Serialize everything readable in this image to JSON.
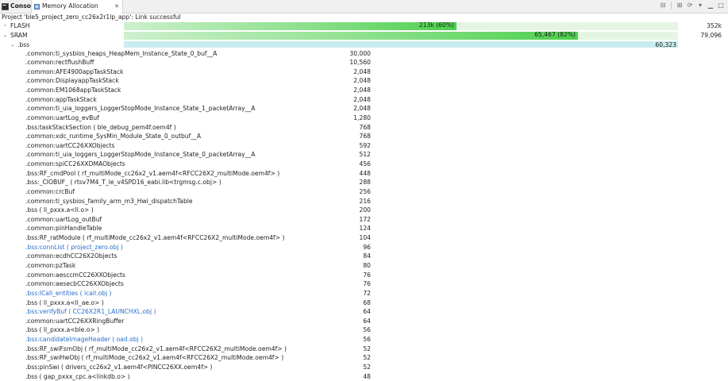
{
  "tabs": {
    "console": "Console",
    "memory": "Memory Allocation"
  },
  "status": "Project 'ble5_project_zero_cc26x2r1lp_app': Link successful",
  "toolbar_icons": [
    "collapse-all-icon",
    "expand-all-icon",
    "refresh-icon",
    "view-menu-icon",
    "minimize-icon",
    "maximize-icon"
  ],
  "flash": {
    "label": "FLASH",
    "used_text": "213k (60%)",
    "total": "352k",
    "fraction": 0.6
  },
  "sram": {
    "label": "SRAM",
    "used_text": "65,467 (82%)",
    "total": "79,096",
    "fraction": 0.82
  },
  "bss": {
    "label": ".bss",
    "value": "60,323"
  },
  "colors": {
    "bar_green": "#4dd04d",
    "bar_bss": "#c9ecef",
    "link": "#2a6fc9"
  },
  "items": [
    {
      "name": ".common:ti_sysbios_heaps_HeapMem_Instance_State_0_buf__A",
      "size": "30,000",
      "link": false
    },
    {
      "name": ".common:rectflushBuff",
      "size": "10,560",
      "link": false
    },
    {
      "name": ".common:AFE4900appTaskStack",
      "size": "2,048",
      "link": false
    },
    {
      "name": ".common:DisplayappTaskStack",
      "size": "2,048",
      "link": false
    },
    {
      "name": ".common:EM1068appTaskStack",
      "size": "2,048",
      "link": false
    },
    {
      "name": ".common:appTaskStack",
      "size": "2,048",
      "link": false
    },
    {
      "name": ".common:ti_uia_loggers_LoggerStopMode_Instance_State_1_packetArray__A",
      "size": "2,048",
      "link": false
    },
    {
      "name": ".common:uartLog_evBuf",
      "size": "1,280",
      "link": false
    },
    {
      "name": ".bss:taskStackSection ( ble_debug_pem4f.oem4f )",
      "size": "768",
      "link": false
    },
    {
      "name": ".common:xdc_runtime_SysMin_Module_State_0_outbuf__A",
      "size": "768",
      "link": false
    },
    {
      "name": ".common:uartCC26XXObjects",
      "size": "592",
      "link": false
    },
    {
      "name": ".common:ti_uia_loggers_LoggerStopMode_Instance_State_0_packetArray__A",
      "size": "512",
      "link": false
    },
    {
      "name": ".common:spiCC26XXDMAObjects",
      "size": "456",
      "link": false
    },
    {
      "name": ".bss:RF_cmdPool ( rf_multiMode_cc26x2_v1.aem4f<RFCC26X2_multiMode.oem4f> )",
      "size": "448",
      "link": false
    },
    {
      "name": ".bss:_CIOBUF_ ( rtsv7M4_T_le_v4SPD16_eabi.lib<trgmsg.c.obj> )",
      "size": "288",
      "link": false
    },
    {
      "name": ".common:crcBuf",
      "size": "256",
      "link": false
    },
    {
      "name": ".common:ti_sysbios_family_arm_m3_Hwi_dispatchTable",
      "size": "216",
      "link": false
    },
    {
      "name": ".bss ( ll_pxxx.a<ll.o> )",
      "size": "200",
      "link": false
    },
    {
      "name": ".common:uartLog_outBuf",
      "size": "172",
      "link": false
    },
    {
      "name": ".common:pinHandleTable",
      "size": "124",
      "link": false
    },
    {
      "name": ".bss:RF_ratModule ( rf_multiMode_cc26x2_v1.aem4f<RFCC26X2_multiMode.oem4f> )",
      "size": "104",
      "link": false
    },
    {
      "name": ".bss:connList ( project_zero.obj )",
      "size": "96",
      "link": true
    },
    {
      "name": ".common:ecdhCC26X2Objects",
      "size": "84",
      "link": false
    },
    {
      "name": ".common:pzTask",
      "size": "80",
      "link": false
    },
    {
      "name": ".common:aesccmCC26XXObjects",
      "size": "76",
      "link": false
    },
    {
      "name": ".common:aesecbCC26XXObjects",
      "size": "76",
      "link": false
    },
    {
      "name": ".bss:ICall_entities ( icall.obj )",
      "size": "72",
      "link": true
    },
    {
      "name": ".bss ( ll_pxxx.a<ll_ae.o> )",
      "size": "68",
      "link": false
    },
    {
      "name": ".bss:verifyBuf ( CC26X2R1_LAUNCHXL.obj )",
      "size": "64",
      "link": true
    },
    {
      "name": ".common:uartCC26XXRingBuffer",
      "size": "64",
      "link": false
    },
    {
      "name": ".bss ( ll_pxxx.a<ble.o> )",
      "size": "56",
      "link": false
    },
    {
      "name": ".bss:candidateImageHeader ( oad.obj )",
      "size": "56",
      "link": true
    },
    {
      "name": ".bss:RF_swiFsmObj ( rf_multiMode_cc26x2_v1.aem4f<RFCC26X2_multiMode.oem4f> )",
      "size": "52",
      "link": false
    },
    {
      "name": ".bss:RF_swiHwObj ( rf_multiMode_cc26x2_v1.aem4f<RFCC26X2_multiMode.oem4f> )",
      "size": "52",
      "link": false
    },
    {
      "name": ".bss:pinSwi ( drivers_cc26x2_v1.aem4f<PINCC26XX.oem4f> )",
      "size": "52",
      "link": false
    },
    {
      "name": ".bss ( gap_pxxx_cpc.a<linkdb.o> )",
      "size": "48",
      "link": false
    }
  ]
}
